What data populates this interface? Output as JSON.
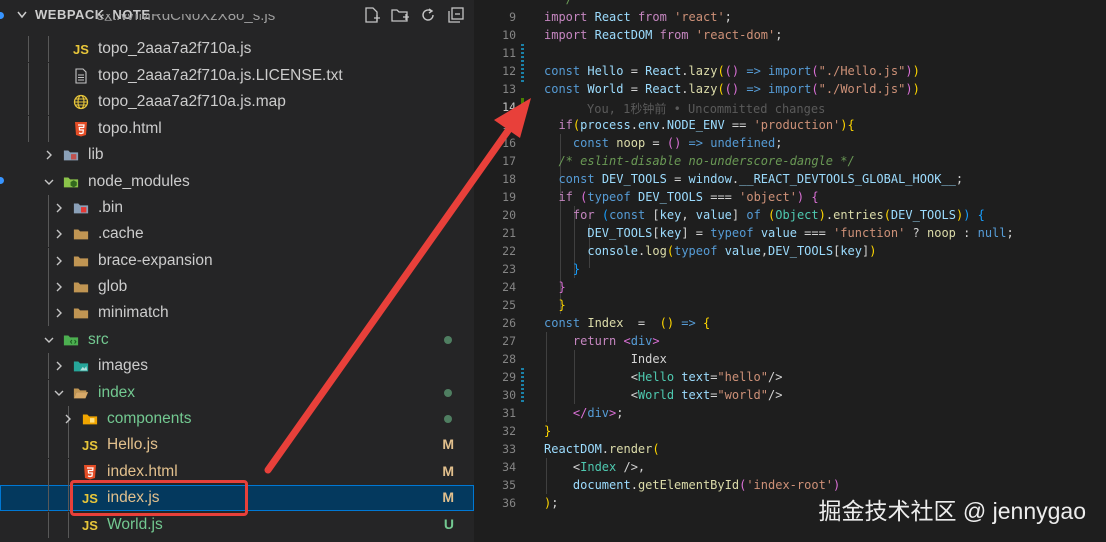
{
  "sidebar": {
    "title": "WEBPACK_NOTE",
    "partial_top": "ext.WfMRdCNoXzX8o_s.js",
    "actions": [
      "new-file-icon",
      "new-folder-icon",
      "refresh-icon",
      "collapse-all-icon"
    ],
    "items": [
      {
        "label": "topo_2aaa7a2f710a.js",
        "icon": "js",
        "kind": "file"
      },
      {
        "label": "topo_2aaa7a2f710a.js.LICENSE.txt",
        "icon": "text-lines",
        "kind": "file"
      },
      {
        "label": "topo_2aaa7a2f710a.js.map",
        "icon": "globe",
        "kind": "file"
      },
      {
        "label": "topo.html",
        "icon": "html5",
        "kind": "file"
      },
      {
        "label": "lib",
        "icon": "folder-lib",
        "kind": "folder",
        "expanded": false
      },
      {
        "label": "node_modules",
        "icon": "folder-node",
        "kind": "folder",
        "expanded": true
      },
      {
        "label": ".bin",
        "icon": "folder-bin",
        "kind": "folder",
        "expanded": false
      },
      {
        "label": ".cache",
        "icon": "folder",
        "kind": "folder",
        "expanded": false
      },
      {
        "label": "brace-expansion",
        "icon": "folder",
        "kind": "folder",
        "expanded": false
      },
      {
        "label": "glob",
        "icon": "folder",
        "kind": "folder",
        "expanded": false
      },
      {
        "label": "minimatch",
        "icon": "folder",
        "kind": "folder",
        "expanded": false
      },
      {
        "label": "src",
        "icon": "folder-src",
        "kind": "folder",
        "expanded": true,
        "status": "dot"
      },
      {
        "label": "images",
        "icon": "folder-images",
        "kind": "folder",
        "expanded": false
      },
      {
        "label": "index",
        "icon": "folder",
        "kind": "folder",
        "expanded": true,
        "status": "dot"
      },
      {
        "label": "components",
        "icon": "folder-components",
        "kind": "folder",
        "expanded": false,
        "status": "dot"
      },
      {
        "label": "Hello.js",
        "icon": "js",
        "kind": "file",
        "status": "M"
      },
      {
        "label": "index.html",
        "icon": "html5",
        "kind": "file",
        "status": "M"
      },
      {
        "label": "index.js",
        "icon": "js",
        "kind": "file",
        "status": "M",
        "selected": true
      },
      {
        "label": "World.js",
        "icon": "js",
        "kind": "file",
        "status": "U"
      }
    ]
  },
  "editor": {
    "blame": "You, 1秒钟前 • Uncommitted changes",
    "line_numbers": [
      "9",
      "10",
      "11",
      "12",
      "13",
      "14",
      "15",
      "16",
      "17",
      "18",
      "19",
      "20",
      "21",
      "22",
      "23",
      "24",
      "25",
      "26",
      "27",
      "28",
      "29",
      "30",
      "31",
      "32",
      "33",
      "34",
      "35",
      "36"
    ],
    "current_line": "14"
  },
  "watermark": "掘金技术社区 @ jennygao",
  "colors": {
    "sidebar_bg": "#252526",
    "editor_bg": "#1e1e1e",
    "selection": "#04395e",
    "modified": "#e2c08d",
    "untracked": "#73c991",
    "annotation": "#e8403a"
  }
}
